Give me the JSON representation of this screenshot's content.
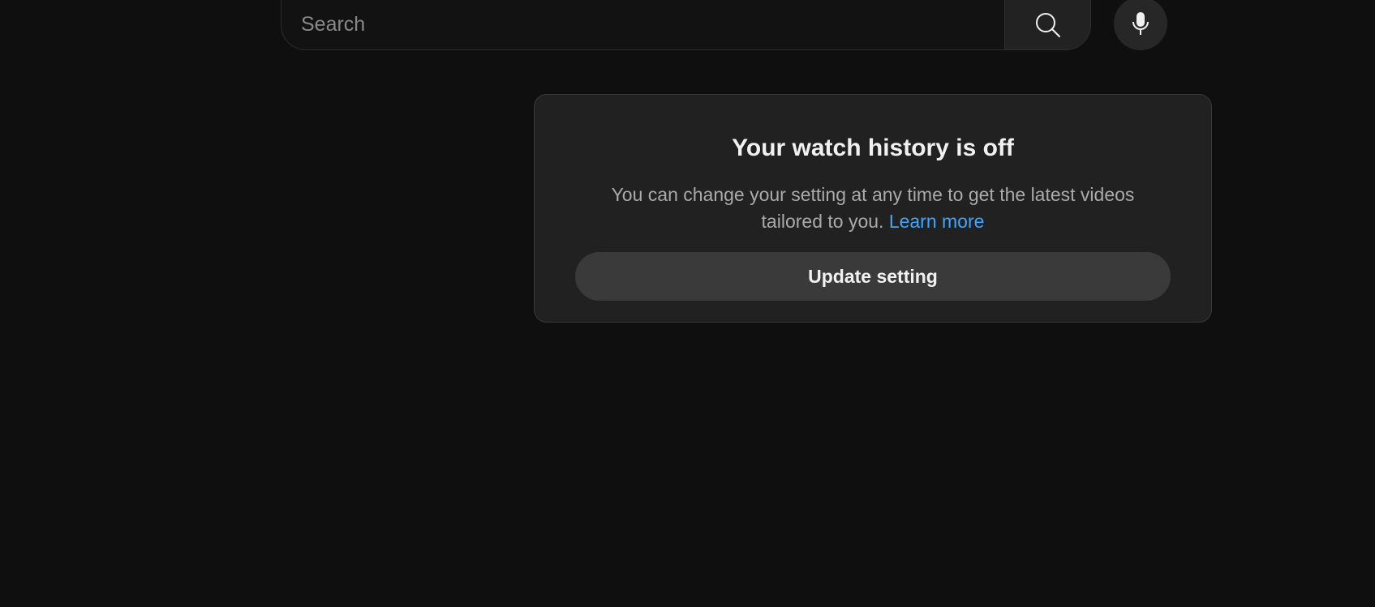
{
  "search": {
    "placeholder": "Search",
    "button_icon": "search-icon",
    "mic_icon": "microphone-icon"
  },
  "history_card": {
    "title": "Your watch history is off",
    "body": "You can change your setting at any time to get the latest videos tailored to you.",
    "learn_more": "Learn more",
    "button_label": "Update setting"
  },
  "colors": {
    "background": "#0f0f0f",
    "card": "#212121",
    "link": "#3ea6ff",
    "button": "#3a3a3a"
  }
}
